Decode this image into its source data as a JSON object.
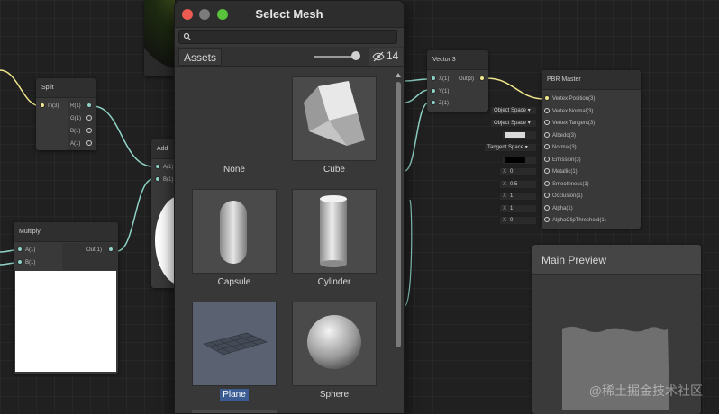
{
  "dialog": {
    "title": "Select Mesh",
    "search_placeholder": "",
    "tab_label": "Assets",
    "hidden_count": "14",
    "slider_fraction": 0.92,
    "items": [
      {
        "label": "None",
        "icon": "none"
      },
      {
        "label": "Cube",
        "icon": "cube-icon"
      },
      {
        "label": "Capsule",
        "icon": "capsule-icon"
      },
      {
        "label": "Cylinder",
        "icon": "cylinder-icon"
      },
      {
        "label": "Plane",
        "icon": "plane-icon",
        "selected": true
      },
      {
        "label": "Sphere",
        "icon": "sphere-icon"
      }
    ]
  },
  "nodes": {
    "split": {
      "title": "Split",
      "inputs": [
        "In(3)"
      ],
      "outputs": [
        "R(1)",
        "G(1)",
        "B(1)",
        "A(1)"
      ]
    },
    "add": {
      "title": "Add",
      "inputs": [
        "A(1)",
        "B(1)"
      ]
    },
    "multiply": {
      "title": "Multiply",
      "inputs": [
        "A(1)",
        "B(1)"
      ],
      "outputs": [
        "Out(1)"
      ]
    },
    "vector3": {
      "title": "Vector 3",
      "inputs": [
        "X(1)",
        "Y(1)",
        "Z(1)"
      ],
      "outputs": [
        "Out(3)"
      ]
    },
    "pbr_master": {
      "title": "PBR Master",
      "ports": [
        "Vertex Position(3)",
        "Vertex Normal(3)",
        "Vertex Tangent(3)",
        "Albedo(3)",
        "Normal(3)",
        "Emission(3)",
        "Metallic(1)",
        "Smoothness(1)",
        "Occlusion(1)",
        "Alpha(1)",
        "AlphaClipThreshold(1)"
      ],
      "fields": {
        "normal_space": "Object Space",
        "tangent_space": "Object Space",
        "normal_tangent_space": "Tangent Space",
        "metallic_axis": "X",
        "metallic": "0",
        "smoothness_axis": "X",
        "smoothness": "0.5",
        "occlusion_axis": "X",
        "occlusion": "1",
        "alpha_axis": "X",
        "alpha": "1",
        "clip_axis": "X",
        "clip": "0"
      }
    }
  },
  "main_preview": {
    "title": "Main Preview"
  },
  "watermark": "@稀土掘金技术社区",
  "colors": {
    "wire": "#8ed3c6",
    "wire_vector": "#f0e68c",
    "selected_label_bg": "#3a5c92"
  }
}
